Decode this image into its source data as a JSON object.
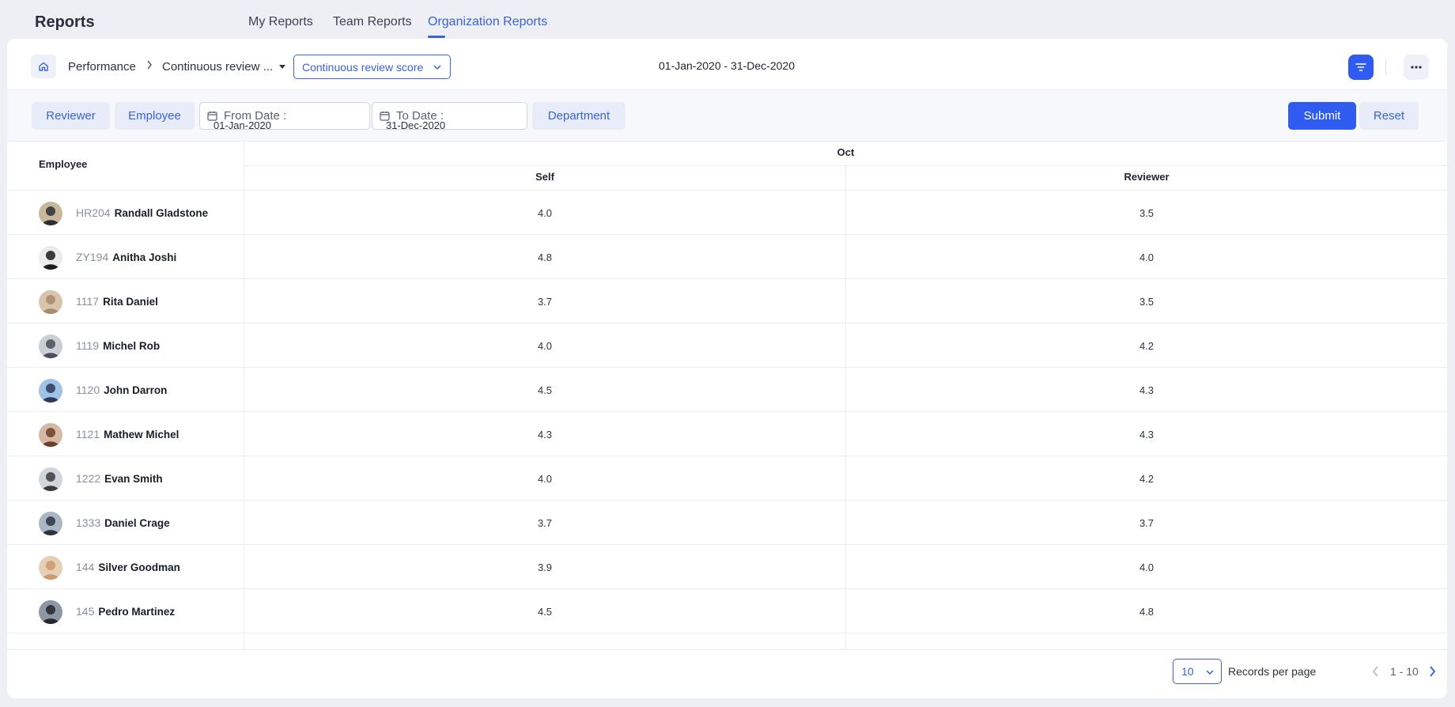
{
  "header": {
    "title": "Reports",
    "tabs": [
      {
        "label": "My Reports",
        "active": false
      },
      {
        "label": "Team Reports",
        "active": false
      },
      {
        "label": "Organization Reports",
        "active": true
      }
    ]
  },
  "breadcrumb": {
    "items": [
      "Performance",
      "Continuous review ..."
    ],
    "selected_report": "Continuous review score",
    "date_range": "01-Jan-2020 - 31-Dec-2020"
  },
  "filters": {
    "reviewer_label": "Reviewer",
    "employee_label": "Employee",
    "from_date_label": "From Date :",
    "from_date_value": "01-Jan-2020",
    "to_date_label": "To Date :",
    "to_date_value": "31-Dec-2020",
    "department_label": "Department",
    "submit_label": "Submit",
    "reset_label": "Reset"
  },
  "table": {
    "employee_header": "Employee",
    "month": "Oct",
    "columns": [
      "Self",
      "Reviewer"
    ],
    "rows": [
      {
        "code": "HR204",
        "name": "Randall Gladstone",
        "self": "4.0",
        "reviewer": "3.5"
      },
      {
        "code": "ZY194",
        "name": "Anitha Joshi",
        "self": "4.8",
        "reviewer": "4.0"
      },
      {
        "code": "1117",
        "name": "Rita Daniel",
        "self": "3.7",
        "reviewer": "3.5"
      },
      {
        "code": "1119",
        "name": "Michel Rob",
        "self": "4.0",
        "reviewer": "4.2"
      },
      {
        "code": "1120",
        "name": "John Darron",
        "self": "4.5",
        "reviewer": "4.3"
      },
      {
        "code": "1121",
        "name": "Mathew Michel",
        "self": "4.3",
        "reviewer": "4.3"
      },
      {
        "code": "1222",
        "name": "Evan Smith",
        "self": "4.0",
        "reviewer": "4.2"
      },
      {
        "code": "1333",
        "name": "Daniel Crage",
        "self": "3.7",
        "reviewer": "3.7"
      },
      {
        "code": "144",
        "name": "Silver Goodman",
        "self": "3.9",
        "reviewer": "4.0"
      },
      {
        "code": "145",
        "name": "Pedro Martinez",
        "self": "4.5",
        "reviewer": "4.8"
      }
    ]
  },
  "pagination": {
    "per_page_value": "10",
    "per_page_label": "Records per page",
    "range": "1 - 10"
  },
  "colors": {
    "accent": "#2f5bf0",
    "link": "#3a63d8",
    "background": "#edeff5"
  }
}
